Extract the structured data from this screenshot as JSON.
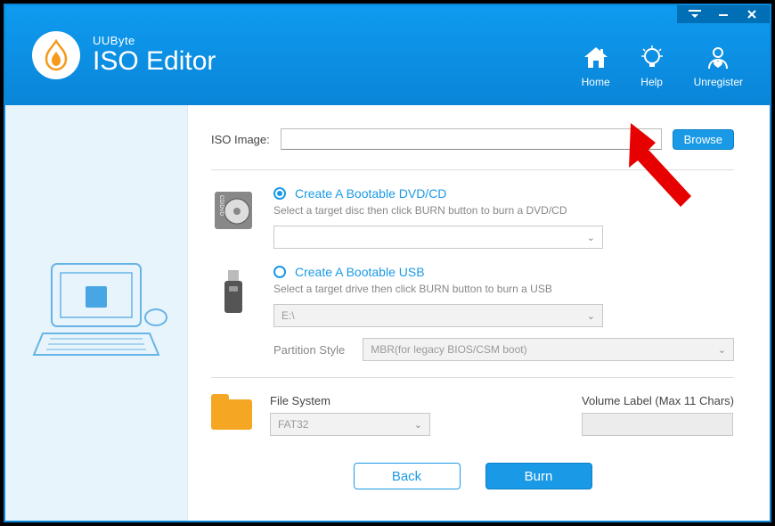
{
  "titlebar": {
    "dropdown_icon": "chevron-down",
    "minimize_icon": "minimize",
    "close_icon": "close"
  },
  "header": {
    "brand_sub": "UUByte",
    "brand_main": "ISO Editor",
    "nav": {
      "home": "Home",
      "help": "Help",
      "unregister": "Unregister"
    }
  },
  "main": {
    "iso_label": "ISO Image:",
    "iso_value": "",
    "browse_label": "Browse",
    "dvd": {
      "title": "Create A Bootable DVD/CD",
      "hint": "Select a target disc then click BURN button to burn a DVD/CD",
      "selected": true,
      "dropdown_value": ""
    },
    "usb": {
      "title": "Create A Bootable USB",
      "hint": "Select a target drive then click BURN button to burn a USB",
      "selected": false,
      "drive_value": "E:\\",
      "partition_label": "Partition Style",
      "partition_value": "MBR(for legacy BIOS/CSM boot)"
    },
    "fs": {
      "label": "File System",
      "value": "FAT32"
    },
    "volume": {
      "label": "Volume Label (Max 11 Chars)",
      "value": ""
    },
    "buttons": {
      "back": "Back",
      "burn": "Burn"
    }
  }
}
